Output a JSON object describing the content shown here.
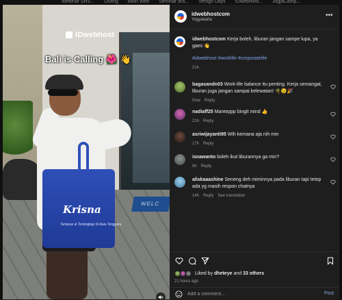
{
  "bookmarks": [
    "Webinar SHS...",
    "Outing",
    "Bikin Web",
    "Seminar ara...",
    "Vertigo Days",
    "IDwebHost...",
    "JogjaCamp..."
  ],
  "media": {
    "brand_sign": "IDwebhost",
    "overlay_text": "Bali is Calling",
    "bag_logo": "Krisna",
    "bag_subtext": "Terbesar & Terlengkap Di Asia Tenggara",
    "mat_text": "WELC"
  },
  "header": {
    "username": "idwebhostcom",
    "location": "Yogyakarta"
  },
  "caption": {
    "username": "idwebhostcom",
    "text": "Kerja boleh, liburan jangan sampe lupa, ya gaes 👋",
    "hashtags": "#idwebhost #worklife #corporatelife",
    "time": "21h"
  },
  "comments": [
    {
      "username": "bagasandn03",
      "text": "Work-life balance itu penting. Kerja semangat, liburan juga jangan sampai kelewatan! 🌴😉🎉",
      "time": "Now",
      "reply": "Reply",
      "extra": ""
    },
    {
      "username": "nadiaff25",
      "text": "Manteppp bingit mind 👍",
      "time": "21h",
      "reply": "Reply",
      "extra": ""
    },
    {
      "username": "asriwijayanti95",
      "text": "Wih kemana aja nih min",
      "time": "17h",
      "reply": "Reply",
      "extra": ""
    },
    {
      "username": "isnawanto",
      "text": "boleh ikut liburannya ga min?",
      "time": "9h",
      "reply": "Reply",
      "extra": ""
    },
    {
      "username": "aliskaaashine",
      "text": "Seneng deh miminnya pada liburan tapi tetep ada yg masih respon chatnya",
      "time": "14h",
      "reply": "Reply",
      "extra": "See translation"
    }
  ],
  "likes": {
    "prefix": "Liked by",
    "user": "dheteye",
    "and": "and",
    "others": "33 others",
    "time_ago": "21 hours ago"
  },
  "add_comment": {
    "placeholder": "Add a comment...",
    "post_label": "Post"
  }
}
